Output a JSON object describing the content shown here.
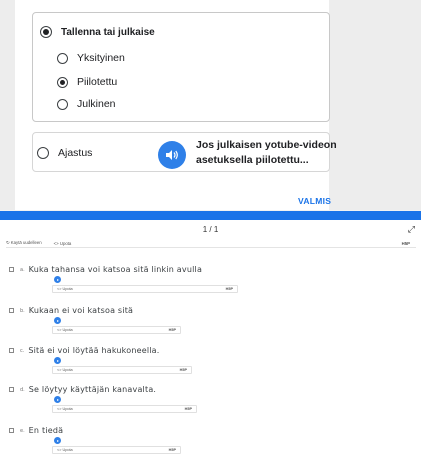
{
  "dialog": {
    "save_or_publish_label": "Tallenna tai julkaise",
    "visibility_options": [
      {
        "label": "Yksityinen",
        "checked": false
      },
      {
        "label": "Piilotettu",
        "checked": true
      },
      {
        "label": "Julkinen",
        "checked": false
      }
    ],
    "schedule_label": "Ajastus",
    "speak_text_line1": "Jos julkaisen yotube-videon",
    "speak_text_line2": "asetuksella piilotettu...",
    "done_label": "VALMIS"
  },
  "player": {
    "page_indicator": "1 / 1",
    "expand_icon": "expand-arrows-icon",
    "retry_label": "Kaytä uudelleen",
    "embed_label": "<> Upota",
    "h5p_label": "H5P",
    "accent_color": "#1a73e8"
  },
  "answers": [
    {
      "letter": "a.",
      "text": "Kuka tahansa voi katsoa sitä linkin avulla",
      "embed": "<> Upota",
      "h5p": "H5P"
    },
    {
      "letter": "b.",
      "text": "Kukaan ei voi katsoa sitä",
      "embed": "<> Upota",
      "h5p": "H5P"
    },
    {
      "letter": "c.",
      "text": "Sitä ei voi löytää hakukoneella.",
      "embed": "<> Upota",
      "h5p": "H5P"
    },
    {
      "letter": "d.",
      "text": "Se löytyy käyttäjän kanavalta.",
      "embed": "<> Upota",
      "h5p": "H5P"
    },
    {
      "letter": "e.",
      "text": "En tiedä",
      "embed": "<> Upota",
      "h5p": "H5P"
    }
  ]
}
